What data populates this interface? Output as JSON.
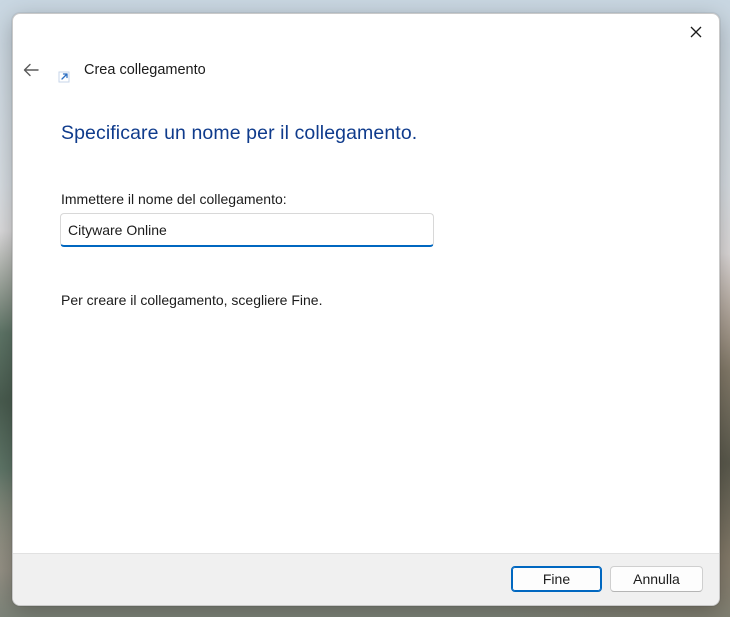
{
  "window": {
    "title": "Crea collegamento"
  },
  "header": {
    "back_icon": "arrow-left-icon",
    "wizard_icon": "shortcut-arrow-icon",
    "close_icon": "close-icon"
  },
  "main": {
    "heading": "Specificare un nome per il collegamento.",
    "field_label": "Immettere il nome del collegamento:",
    "name_value": "Cityware Online",
    "hint": "Per creare il collegamento, scegliere Fine."
  },
  "footer": {
    "finish_label": "Fine",
    "cancel_label": "Annulla"
  },
  "colors": {
    "heading": "#0f3b8c",
    "accent": "#0067c0"
  }
}
